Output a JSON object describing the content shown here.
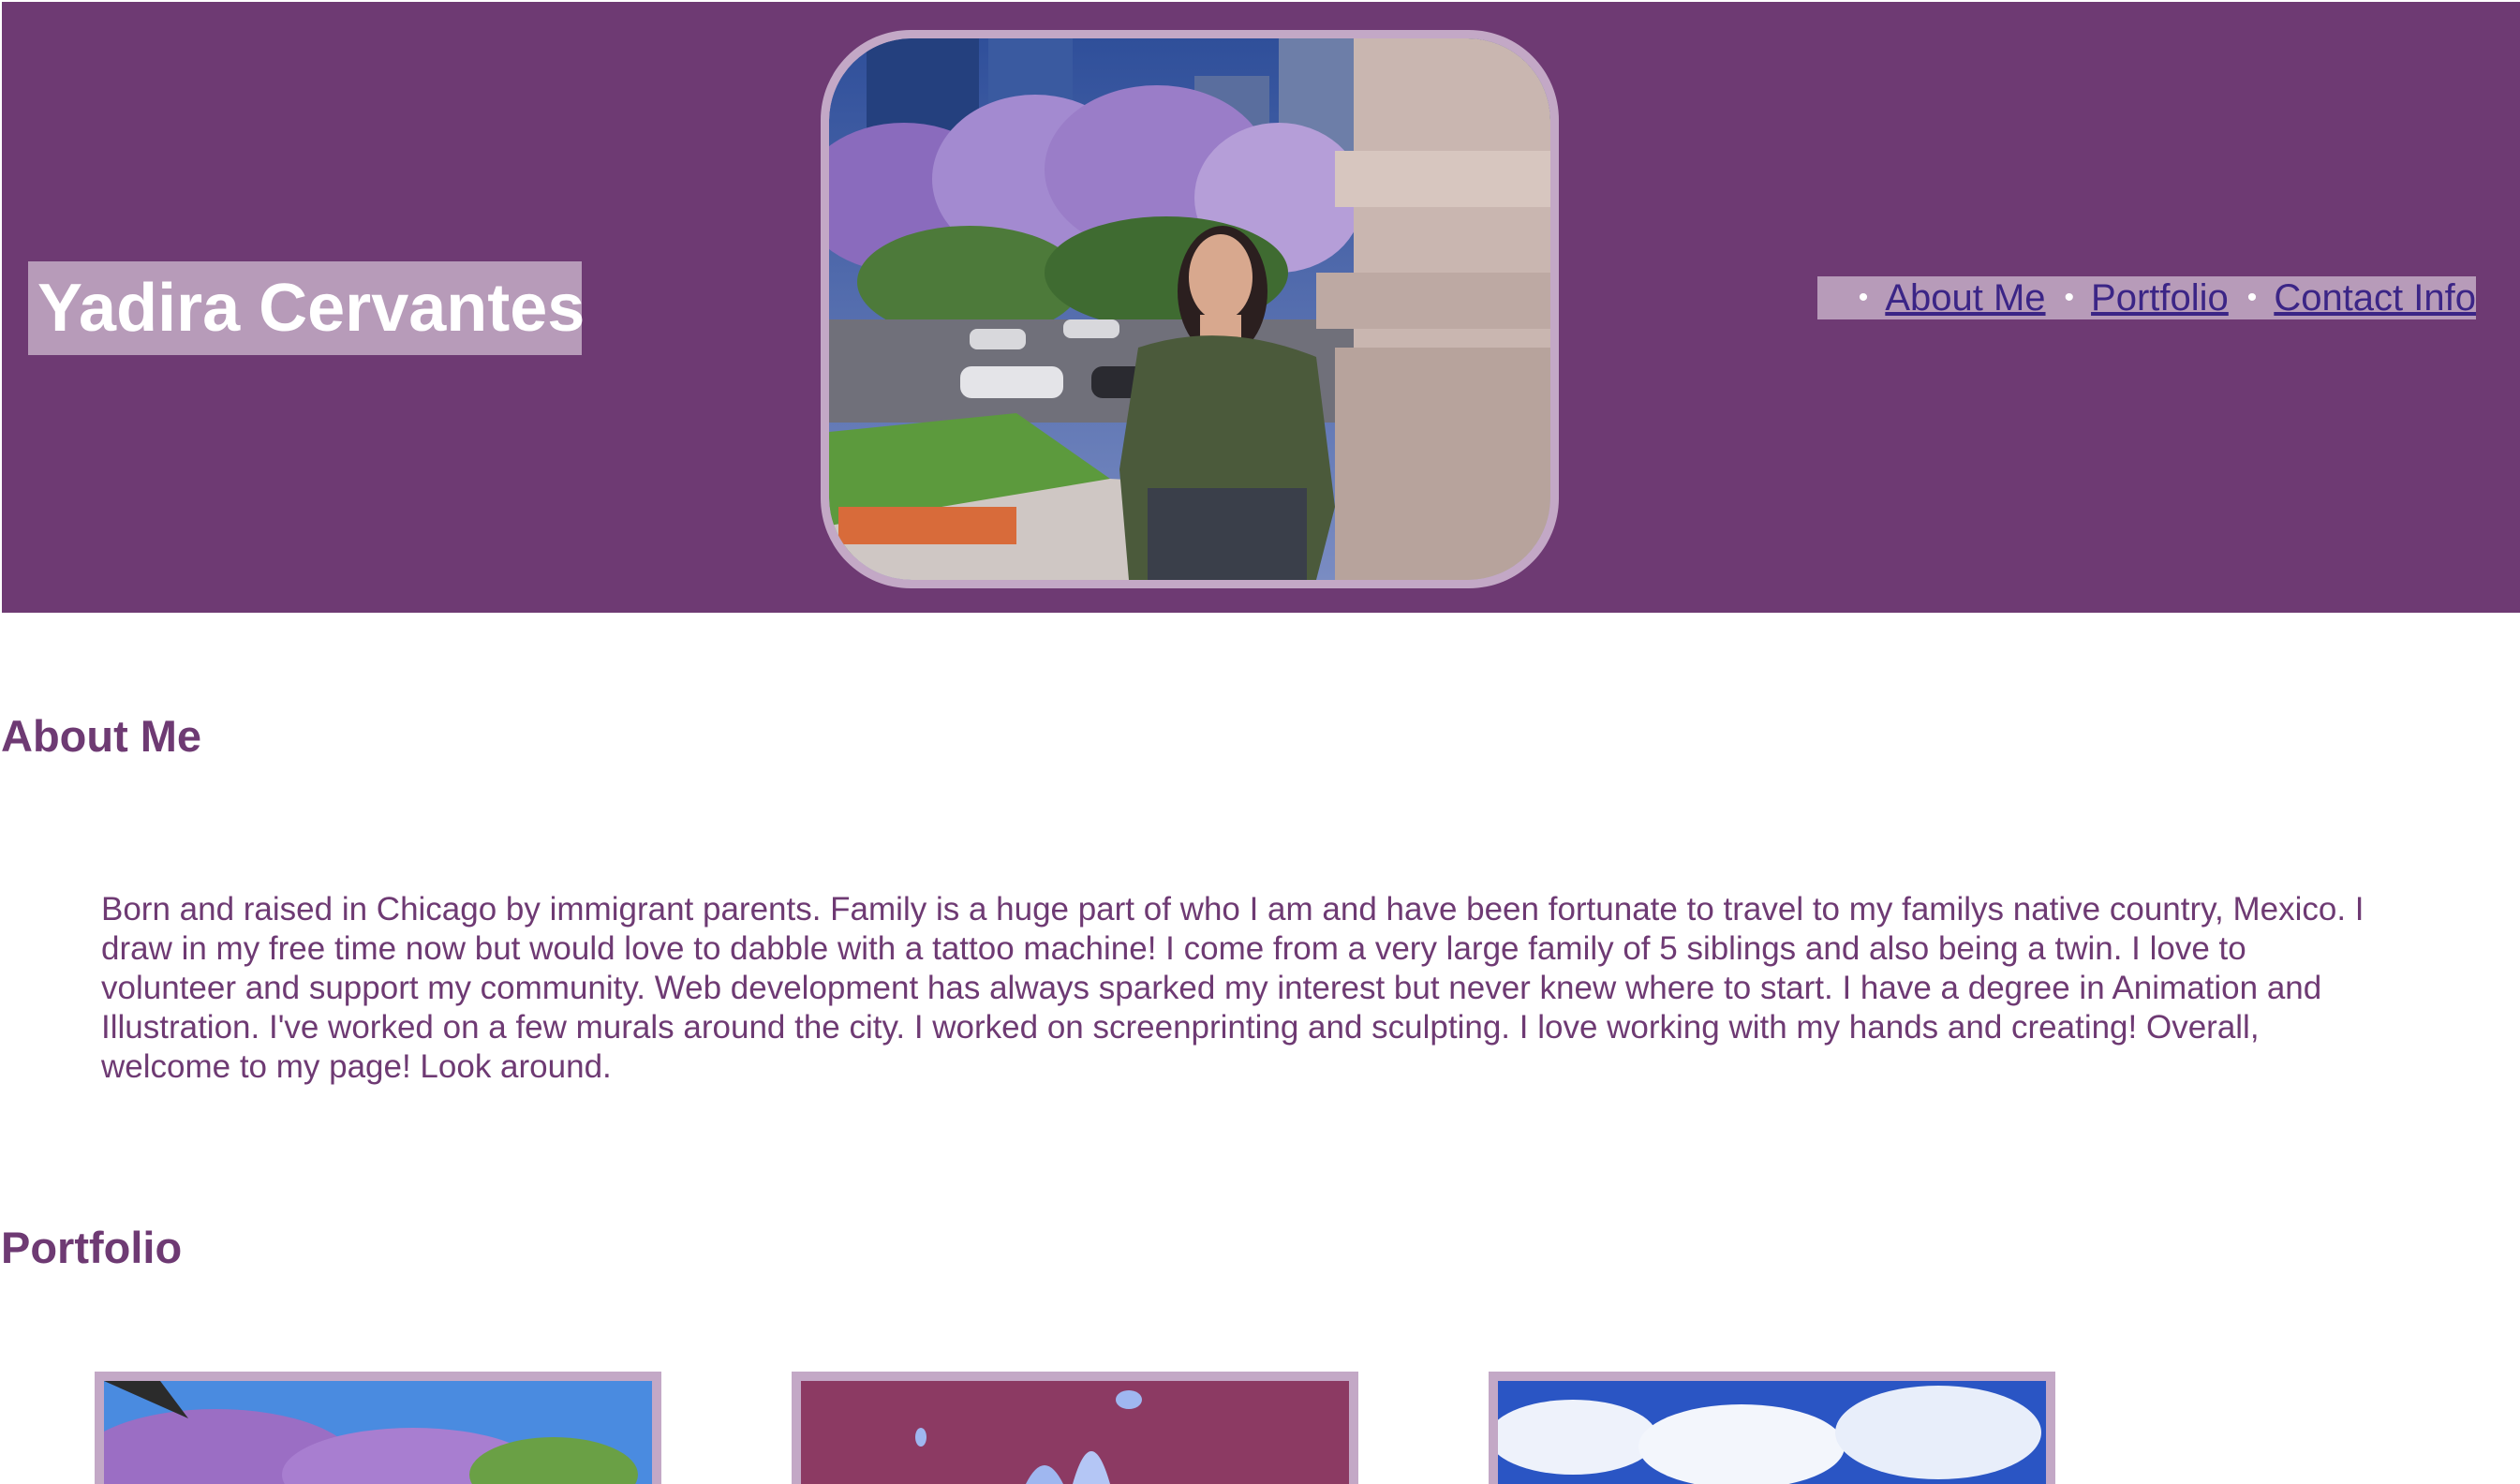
{
  "header": {
    "site_title": "Yadira Cervantes",
    "hero_image": "portrait-photo",
    "background_color": "#6e3a73",
    "accent_color": "#b79bb9"
  },
  "nav": {
    "items": [
      {
        "label": "About Me"
      },
      {
        "label": "Portfolio"
      },
      {
        "label": "Contact Info"
      }
    ],
    "bullet": "•"
  },
  "about": {
    "heading": "About Me",
    "text": "Born and raised in Chicago by immigrant parents. Family is a huge part of who I am and have been fortunate to travel to my familys native country, Mexico. I draw in my free time now but would love to dabble with a tattoo machine! I come from a very large family of 5 siblings and also being a twin. I love to volunteer and support my community. Web development has always sparked my interest but never knew where to start. I have a degree in Animation and Illustration. I've worked on a few murals around the city. I worked on screenprinting and sculpting. I love working with my hands and creating! Overall, welcome to my page! Look around."
  },
  "portfolio": {
    "heading": "Portfolio",
    "items": [
      {
        "image": "jacaranda-tree-photo"
      },
      {
        "image": "illustration-artwork"
      },
      {
        "image": "cloudy-sky-photo"
      }
    ]
  }
}
